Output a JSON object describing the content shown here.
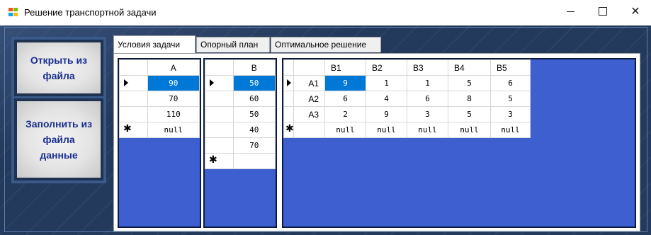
{
  "window": {
    "title": "Решение транспортной задачи",
    "min_glyph": "—",
    "close_glyph": "✕"
  },
  "sidebar": {
    "open_button": "Открыть из файла",
    "fill_button": "Заполнить из файла данные"
  },
  "tabs": [
    {
      "label": "Условия задачи",
      "active": true
    },
    {
      "label": "Опорный план",
      "active": false
    },
    {
      "label": "Оптимальное решение",
      "active": false
    }
  ],
  "grid_a": {
    "header": "A",
    "rows": [
      "90",
      "70",
      "110",
      "null"
    ],
    "selected_row": 0,
    "new_row_glyph": "✱"
  },
  "grid_b": {
    "header": "B",
    "rows": [
      "50",
      "60",
      "50",
      "40",
      "70"
    ],
    "selected_row": 0,
    "new_row_glyph": "✱"
  },
  "grid_c": {
    "columns": [
      "B1",
      "B2",
      "B3",
      "B4",
      "B5"
    ],
    "row_labels": [
      "A1",
      "A2",
      "A3",
      ""
    ],
    "rows": [
      [
        "9",
        "1",
        "1",
        "5",
        "6"
      ],
      [
        "6",
        "4",
        "6",
        "8",
        "5"
      ],
      [
        "2",
        "9",
        "3",
        "5",
        "3"
      ],
      [
        "null",
        "null",
        "null",
        "null",
        "null"
      ]
    ],
    "new_row_glyph": "✱"
  },
  "colors": {
    "grid_background": "#3e5fd0",
    "selection": "#0078d7",
    "button_text": "#1a2f8f",
    "client_background": "#243a5c"
  }
}
